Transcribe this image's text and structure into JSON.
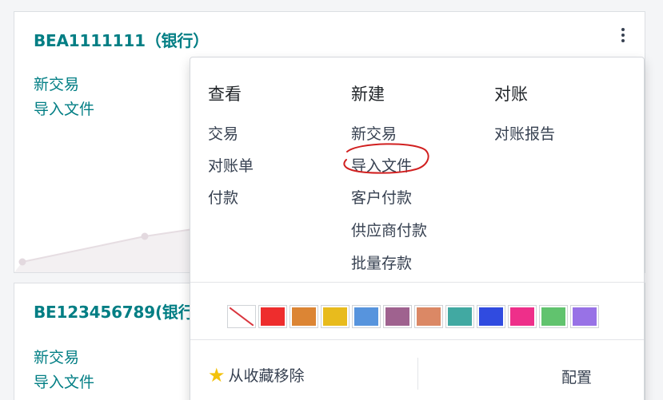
{
  "card1": {
    "title": "BEA1111111（银行）",
    "links": [
      "新交易",
      "导入文件"
    ]
  },
  "card2": {
    "title": "BE123456789(银行",
    "links": [
      "新交易",
      "导入文件"
    ]
  },
  "dropdown": {
    "view": {
      "header": "查看",
      "items": [
        "交易",
        "对账单",
        "付款"
      ]
    },
    "new": {
      "header": "新建",
      "items": [
        "新交易",
        "导入文件",
        "客户付款",
        "供应商付款",
        "批量存款"
      ]
    },
    "reconcile": {
      "header": "对账",
      "items": [
        "对账报告"
      ]
    },
    "colors": [
      "none",
      "#ee2d2d",
      "#dc8534",
      "#e8bb1d",
      "#5794dd",
      "#9f628f",
      "#db8865",
      "#41a9a2",
      "#304be0",
      "#ee2f8a",
      "#61c36e",
      "#9872e6"
    ],
    "footer": {
      "favorite_label": "从收藏移除",
      "config_label": "配置"
    }
  },
  "annotation_color": "#d12020"
}
